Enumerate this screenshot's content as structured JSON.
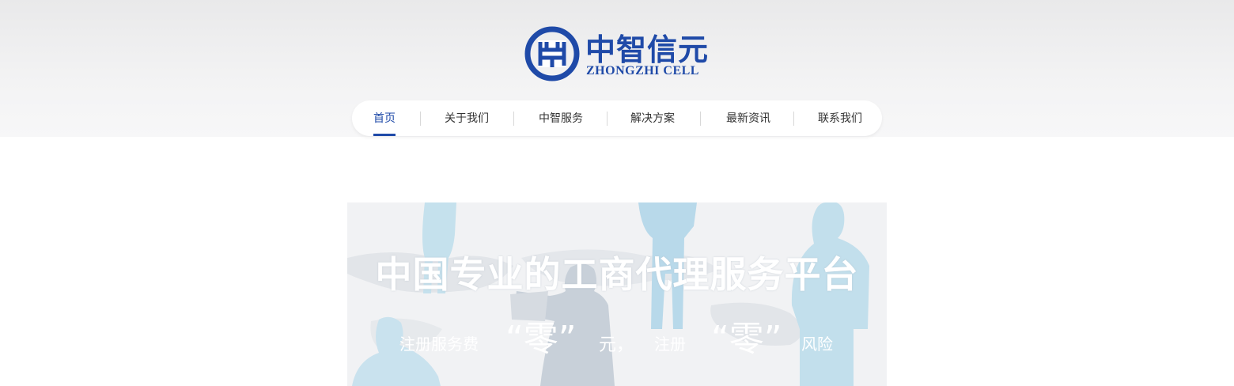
{
  "brand": {
    "name_cn": "中智信元",
    "name_en": "ZHONGZHI CELL",
    "color": "#1f4aa8"
  },
  "nav": {
    "items": [
      {
        "label": "首页",
        "active": true
      },
      {
        "label": "关于我们"
      },
      {
        "label": "中智服务"
      },
      {
        "label": "解决方案"
      },
      {
        "label": "最新资讯"
      },
      {
        "label": "联系我们"
      }
    ]
  },
  "banner": {
    "title": "中国专业的工商代理服务平台",
    "subtitle": {
      "part1": "注册服务费",
      "zero1": "“零”",
      "part2": "元，",
      "part3": "注册",
      "zero2": "“零”",
      "part4": "风险"
    }
  }
}
